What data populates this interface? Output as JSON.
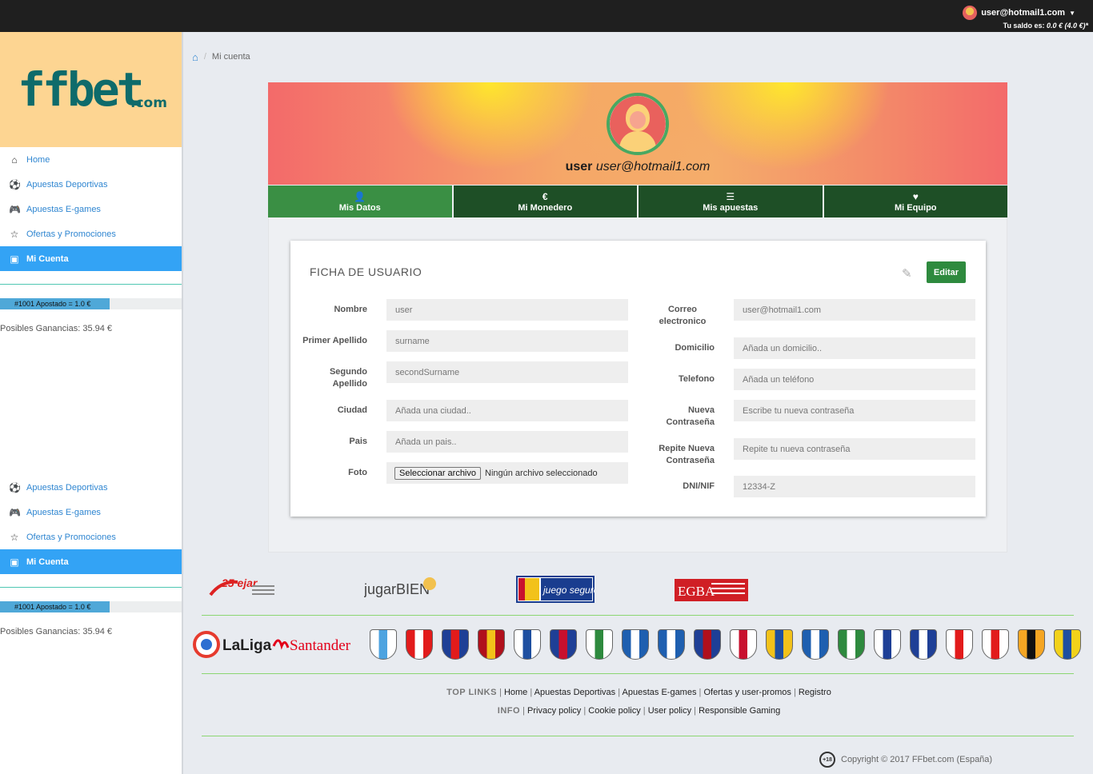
{
  "header": {
    "user_email": "user@hotmail1.com",
    "saldo_label": "Tu saldo es:",
    "saldo_value": "0.0 € (4.0 €)*"
  },
  "sidebar": {
    "logo_main": "ffbet",
    "logo_suffix": ".com",
    "nav": [
      {
        "label": "Home",
        "icon": "home-icon"
      },
      {
        "label": "Apuestas Deportivas",
        "icon": "soccer-ball-icon"
      },
      {
        "label": "Apuestas E-games",
        "icon": "gamepad-icon"
      },
      {
        "label": "Ofertas y Promociones",
        "icon": "star-icon"
      },
      {
        "label": "Mi Cuenta",
        "icon": "id-card-icon"
      }
    ],
    "nav2": [
      {
        "label": "Apuestas Deportivas",
        "icon": "soccer-ball-icon"
      },
      {
        "label": "Apuestas E-games",
        "icon": "gamepad-icon"
      },
      {
        "label": "Ofertas y Promociones",
        "icon": "star-icon"
      },
      {
        "label": "Mi Cuenta",
        "icon": "id-card-icon"
      }
    ],
    "bet_text": "#1001 Apostado = 1.0 €",
    "bet_fill_fraction": 0.6,
    "ganancias": "Posibles Ganancias: 35.94 €"
  },
  "breadcrumb": {
    "current": "Mi cuenta"
  },
  "profile": {
    "username": "user",
    "email": "user@hotmail1.com"
  },
  "tabs": [
    {
      "label": "Mis Datos",
      "icon": "user-icon",
      "glyph": "👤",
      "active": true
    },
    {
      "label": "Mi Monedero",
      "icon": "euro-icon",
      "glyph": "€",
      "active": false
    },
    {
      "label": "Mis apuestas",
      "icon": "list-icon",
      "glyph": "☰",
      "active": false
    },
    {
      "label": "Mi Equipo",
      "icon": "heart-icon",
      "glyph": "♥",
      "active": false
    }
  ],
  "card": {
    "title": "FICHA DE USUARIO",
    "edit_label": "Editar",
    "left_fields": [
      {
        "label": "Nombre",
        "value": "user"
      },
      {
        "label": "Primer Apellido",
        "value": "surname"
      },
      {
        "label": "Segundo Apellido",
        "value": "secondSurname"
      },
      {
        "label": "Ciudad",
        "value": "Añada una ciudad.."
      },
      {
        "label": "Pais",
        "value": "Añada un pais.."
      },
      {
        "label": "Foto",
        "file_button": "Seleccionar archivo",
        "file_status": "Ningún archivo seleccionado"
      }
    ],
    "right_fields": [
      {
        "label": "Correo electronico",
        "value": "user@hotmail1.com"
      },
      {
        "label": "Domicilio",
        "value": "Añada un domicilio.."
      },
      {
        "label": "Telefono",
        "value": "Añada un teléfono"
      },
      {
        "label": "Nueva Contraseña",
        "value": "Escribe tu nueva contraseña"
      },
      {
        "label": "Repite Nueva Contraseña",
        "value": "Repite tu nueva contraseña"
      },
      {
        "label": "DNI/NIF",
        "value": "12334-Z"
      }
    ]
  },
  "footer": {
    "sponsors": [
      "25 ejar",
      "jugarBIEN",
      "juego seguro",
      "EGBA"
    ],
    "laliga": "LaLiga",
    "santander": "Santander",
    "top_links_head": "TOP LINKS",
    "top_links": [
      "Home",
      "Apuestas Deportivas",
      "Apuestas E-games",
      "Ofertas y user-promos",
      "Registro"
    ],
    "info_head": "INFO",
    "info_links": [
      "Privacy policy",
      "Cookie policy",
      "User policy",
      "Responsible Gaming"
    ],
    "badge": "+18",
    "copyright": "Copyright © 2017 FFbet.com (España)"
  },
  "colors": {
    "topbar": "#1f1f1f",
    "logo_bg": "#fdd592",
    "active_nav": "#33a3f5",
    "tab_dark": "#1e4f26",
    "tab_active": "#3a8f44",
    "edit_button": "#2e8a3e"
  }
}
